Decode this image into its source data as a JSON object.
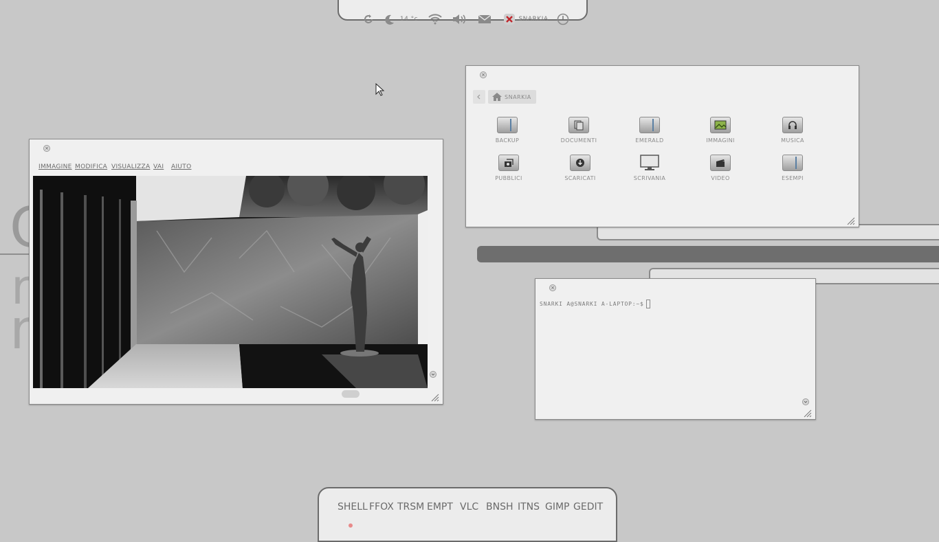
{
  "top_panel": {
    "weather_temp": "14 °c",
    "user_name": "SNARKIA"
  },
  "desktop_background": {
    "glyph_1": "C",
    "glyph_2": "r",
    "glyph_3": "n"
  },
  "image_viewer": {
    "menu": [
      "IMMAGINE",
      "MODIFICA",
      "VISUALIZZA",
      "VAI",
      "AIUTO"
    ]
  },
  "file_manager": {
    "location": "SNARKIA",
    "folders": [
      {
        "label": "BACKUP",
        "icon": "folder-icon"
      },
      {
        "label": "DOCUMENTI",
        "icon": "documents-folder-icon"
      },
      {
        "label": "EMERALD",
        "icon": "folder-icon"
      },
      {
        "label": "IMMAGINI",
        "icon": "pictures-folder-icon"
      },
      {
        "label": "MUSICA",
        "icon": "music-folder-icon"
      },
      {
        "label": "PUBBLICI",
        "icon": "public-folder-icon"
      },
      {
        "label": "SCARICATI",
        "icon": "downloads-folder-icon"
      },
      {
        "label": "SCRIVANIA",
        "icon": "desktop-folder-icon"
      },
      {
        "label": "VIDEO",
        "icon": "video-folder-icon"
      },
      {
        "label": "ESEMPI",
        "icon": "folder-icon"
      }
    ]
  },
  "terminal": {
    "prompt": "SNARKI A@SNARKI A-LAPTOP:~$"
  },
  "dock": {
    "items": [
      "SHELL",
      "FFOX",
      "TRSM",
      "EMPT",
      "VLC",
      "BNSH",
      "ITNS",
      "GIMP",
      "GEDIT"
    ]
  },
  "colors": {
    "desktop_bg": "#c8c8c8",
    "window_bg": "#f0f0f0",
    "panel_border": "#6b6b6b"
  }
}
